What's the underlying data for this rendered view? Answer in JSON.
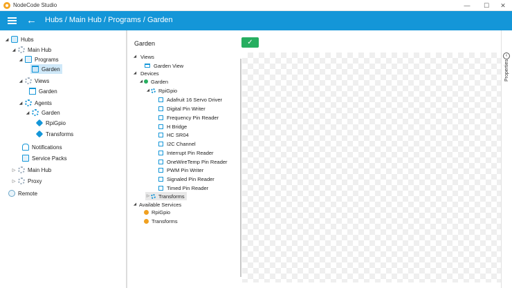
{
  "window": {
    "title": "NodeCode Studio",
    "minimize": "—",
    "maximize": "☐",
    "close": "✕"
  },
  "appbar": {
    "breadcrumb": "Hubs / Main Hub / Programs / Garden",
    "color": "#1496d8"
  },
  "nav_tree": {
    "hubs": "Hubs",
    "main_hub": "Main Hub",
    "programs": "Programs",
    "garden_program": "Garden",
    "views": "Views",
    "garden_view": "Garden",
    "agents": "Agents",
    "garden_agent": "Garden",
    "rpigpio": "RpiGpio",
    "transforms": "Transforms",
    "notifications": "Notifications",
    "service_packs": "Service Packs",
    "main_hub_2": "Main Hub",
    "proxy": "Proxy",
    "remote": "Remote"
  },
  "editor": {
    "name_value": "Garden",
    "confirm_icon": "✓",
    "confirm_color": "#27ae60"
  },
  "program_tree": {
    "views": "Views",
    "garden_view": "Garden View",
    "devices": "Devices",
    "garden": "Garden",
    "rpigpio": "RpiGpio",
    "devices_list": [
      "Adafruit 16 Servo Driver",
      "Digital Pin Writer",
      "Frequency Pin Reader",
      "H Bridge",
      "HC SR04",
      "I2C Channel",
      "Interrupt Pin Reader",
      "OneWireTemp Pin Reader",
      "PWM Pin Writer",
      "Signaled Pin Reader",
      "Timed Pin Reader"
    ],
    "transforms": "Transforms",
    "available_services": "Available Services",
    "svc_rpigpio": "RpiGpio",
    "svc_transforms": "Transforms"
  },
  "properties": {
    "label": "Properties",
    "toggle_icon": "‹"
  }
}
